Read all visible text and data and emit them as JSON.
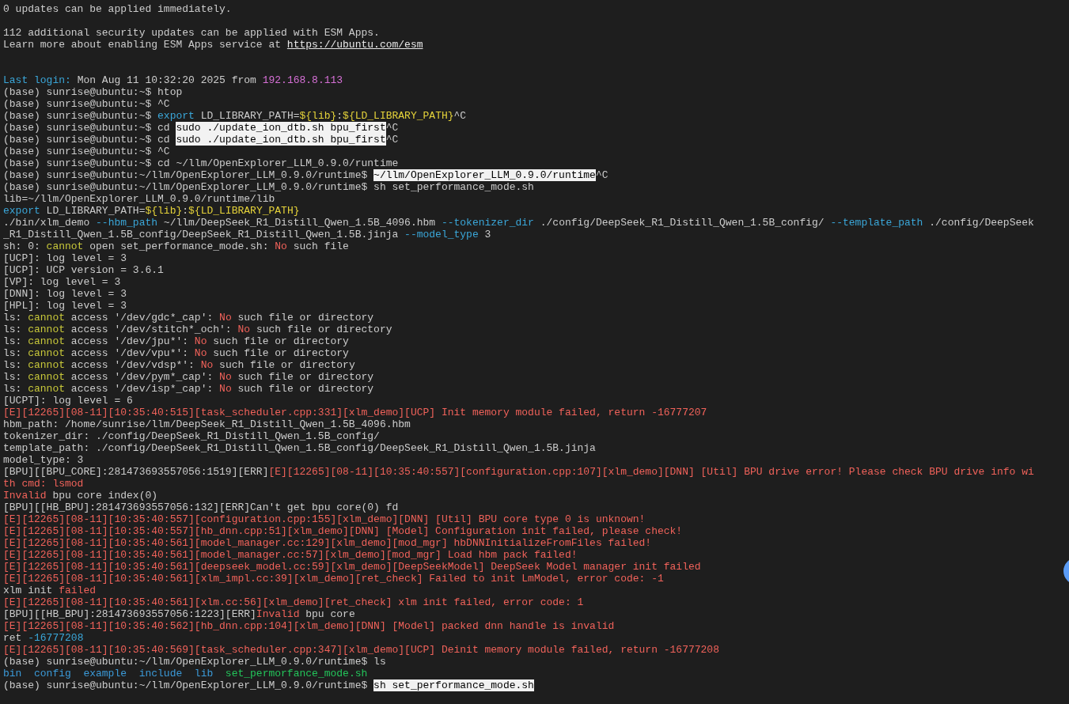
{
  "terminal": {
    "lines": [
      {
        "kind": "text",
        "segments": [
          {
            "text": "0 updates can be applied immediately.",
            "kind": "plain"
          }
        ]
      },
      {
        "kind": "blank"
      },
      {
        "kind": "text",
        "segments": [
          {
            "text": "112 additional security updates can be applied with ESM Apps.",
            "kind": "plain"
          }
        ]
      },
      {
        "kind": "text",
        "segments": [
          {
            "text": "Learn more about enabling ESM Apps service at ",
            "kind": "plain"
          },
          {
            "text": "https://ubuntu.com/esm",
            "kind": "link"
          }
        ]
      },
      {
        "kind": "blank"
      },
      {
        "kind": "blank"
      },
      {
        "kind": "text",
        "segments": [
          {
            "text": "Last login:",
            "kind": "cyan"
          },
          {
            "text": " Mon Aug 11 10:32:20 2025 from ",
            "kind": "plain"
          },
          {
            "text": "192.168.8.113",
            "kind": "magenta"
          }
        ]
      },
      {
        "kind": "text",
        "segments": [
          {
            "text": "(base) sunrise@ubuntu:~$ htop",
            "kind": "plain"
          }
        ]
      },
      {
        "kind": "text",
        "segments": [
          {
            "text": "(base) sunrise@ubuntu:~$ ^C",
            "kind": "plain"
          }
        ]
      },
      {
        "kind": "text",
        "segments": [
          {
            "text": "(base) sunrise@ubuntu:~$ ",
            "kind": "plain"
          },
          {
            "text": "export",
            "kind": "cyan"
          },
          {
            "text": " LD_LIBRARY_PATH=",
            "kind": "plain"
          },
          {
            "text": "${lib}",
            "kind": "yellow"
          },
          {
            "text": ":",
            "kind": "plain"
          },
          {
            "text": "${LD_LIBRARY_PATH}",
            "kind": "yellow"
          },
          {
            "text": "^C",
            "kind": "plain"
          }
        ]
      },
      {
        "kind": "text",
        "segments": [
          {
            "text": "(base) sunrise@ubuntu:~$ cd ",
            "kind": "plain"
          },
          {
            "text": "sudo ./update_ion_dtb.sh bpu_first",
            "kind": "highlight"
          },
          {
            "text": "^C",
            "kind": "plain"
          }
        ]
      },
      {
        "kind": "text",
        "segments": [
          {
            "text": "(base) sunrise@ubuntu:~$ cd ",
            "kind": "plain"
          },
          {
            "text": "sudo ./update_ion_dtb.sh bpu_first",
            "kind": "highlight"
          },
          {
            "text": "^C",
            "kind": "plain"
          }
        ]
      },
      {
        "kind": "text",
        "segments": [
          {
            "text": "(base) sunrise@ubuntu:~$ ^C",
            "kind": "plain"
          }
        ]
      },
      {
        "kind": "text",
        "segments": [
          {
            "text": "(base) sunrise@ubuntu:~$ cd ~/llm/OpenExplorer_LLM_0.9.0/runtime",
            "kind": "plain"
          }
        ]
      },
      {
        "kind": "text",
        "segments": [
          {
            "text": "(base) sunrise@ubuntu:~/llm/OpenExplorer_LLM_0.9.0/runtime$ ",
            "kind": "plain"
          },
          {
            "text": "~/llm/OpenExplorer_LLM_0.9.0/runtime",
            "kind": "highlight"
          },
          {
            "text": "^C",
            "kind": "plain"
          }
        ]
      },
      {
        "kind": "text",
        "segments": [
          {
            "text": "(base) sunrise@ubuntu:~/llm/OpenExplorer_LLM_0.9.0/runtime$ sh set_performance_mode.sh",
            "kind": "plain"
          }
        ]
      },
      {
        "kind": "text",
        "segments": [
          {
            "text": "lib=~/llm/OpenExplorer_LLM_0.9.0/runtime/lib",
            "kind": "plain"
          }
        ]
      },
      {
        "kind": "text",
        "segments": [
          {
            "text": "export",
            "kind": "cyan"
          },
          {
            "text": " LD_LIBRARY_PATH=",
            "kind": "plain"
          },
          {
            "text": "${lib}",
            "kind": "yellow"
          },
          {
            "text": ":",
            "kind": "plain"
          },
          {
            "text": "${LD_LIBRARY_PATH}",
            "kind": "yellow"
          }
        ]
      },
      {
        "kind": "text",
        "segments": [
          {
            "text": "./bin/xlm_demo ",
            "kind": "plain"
          },
          {
            "text": "--hbm_path",
            "kind": "cyan"
          },
          {
            "text": " ~/llm/DeepSeek_R1_Distill_Qwen_1.5B_4096.hbm ",
            "kind": "plain"
          },
          {
            "text": "--tokenizer_dir",
            "kind": "cyan"
          },
          {
            "text": " ./config/DeepSeek_R1_Distill_Qwen_1.5B_config/ ",
            "kind": "plain"
          },
          {
            "text": "--template_path",
            "kind": "cyan"
          },
          {
            "text": " ./config/DeepSeek",
            "kind": "plain"
          }
        ]
      },
      {
        "kind": "text",
        "segments": [
          {
            "text": "_R1_Distill_Qwen_1.5B_config/DeepSeek_R1_Distill_Qwen_1.5B.jinja ",
            "kind": "plain"
          },
          {
            "text": "--model_type",
            "kind": "cyan"
          },
          {
            "text": " 3",
            "kind": "plain"
          }
        ]
      },
      {
        "kind": "text",
        "segments": [
          {
            "text": "sh: 0: ",
            "kind": "plain"
          },
          {
            "text": "cannot",
            "kind": "olive"
          },
          {
            "text": " open set_performance_mode.sh: ",
            "kind": "plain"
          },
          {
            "text": "No",
            "kind": "red"
          },
          {
            "text": " such file",
            "kind": "plain"
          }
        ]
      },
      {
        "kind": "text",
        "segments": [
          {
            "text": "[UCP]: log level = 3",
            "kind": "plain"
          }
        ]
      },
      {
        "kind": "text",
        "segments": [
          {
            "text": "[UCP]: UCP version = 3.6.1",
            "kind": "plain"
          }
        ]
      },
      {
        "kind": "text",
        "segments": [
          {
            "text": "[VP]: log level = 3",
            "kind": "plain"
          }
        ]
      },
      {
        "kind": "text",
        "segments": [
          {
            "text": "[DNN]: log level = 3",
            "kind": "plain"
          }
        ]
      },
      {
        "kind": "text",
        "segments": [
          {
            "text": "[HPL]: log level = 3",
            "kind": "plain"
          }
        ]
      },
      {
        "kind": "text",
        "segments": [
          {
            "text": "ls: ",
            "kind": "plain"
          },
          {
            "text": "cannot",
            "kind": "olive"
          },
          {
            "text": " access '/dev/gdc*_cap': ",
            "kind": "plain"
          },
          {
            "text": "No",
            "kind": "red"
          },
          {
            "text": " such file or directory",
            "kind": "plain"
          }
        ]
      },
      {
        "kind": "text",
        "segments": [
          {
            "text": "ls: ",
            "kind": "plain"
          },
          {
            "text": "cannot",
            "kind": "olive"
          },
          {
            "text": " access '/dev/stitch*_och': ",
            "kind": "plain"
          },
          {
            "text": "No",
            "kind": "red"
          },
          {
            "text": " such file or directory",
            "kind": "plain"
          }
        ]
      },
      {
        "kind": "text",
        "segments": [
          {
            "text": "ls: ",
            "kind": "plain"
          },
          {
            "text": "cannot",
            "kind": "olive"
          },
          {
            "text": " access '/dev/jpu*': ",
            "kind": "plain"
          },
          {
            "text": "No",
            "kind": "red"
          },
          {
            "text": " such file or directory",
            "kind": "plain"
          }
        ]
      },
      {
        "kind": "text",
        "segments": [
          {
            "text": "ls: ",
            "kind": "plain"
          },
          {
            "text": "cannot",
            "kind": "olive"
          },
          {
            "text": " access '/dev/vpu*': ",
            "kind": "plain"
          },
          {
            "text": "No",
            "kind": "red"
          },
          {
            "text": " such file or directory",
            "kind": "plain"
          }
        ]
      },
      {
        "kind": "text",
        "segments": [
          {
            "text": "ls: ",
            "kind": "plain"
          },
          {
            "text": "cannot",
            "kind": "olive"
          },
          {
            "text": " access '/dev/vdsp*': ",
            "kind": "plain"
          },
          {
            "text": "No",
            "kind": "red"
          },
          {
            "text": " such file or directory",
            "kind": "plain"
          }
        ]
      },
      {
        "kind": "text",
        "segments": [
          {
            "text": "ls: ",
            "kind": "plain"
          },
          {
            "text": "cannot",
            "kind": "olive"
          },
          {
            "text": " access '/dev/pym*_cap': ",
            "kind": "plain"
          },
          {
            "text": "No",
            "kind": "red"
          },
          {
            "text": " such file or directory",
            "kind": "plain"
          }
        ]
      },
      {
        "kind": "text",
        "segments": [
          {
            "text": "ls: ",
            "kind": "plain"
          },
          {
            "text": "cannot",
            "kind": "olive"
          },
          {
            "text": " access '/dev/isp*_cap': ",
            "kind": "plain"
          },
          {
            "text": "No",
            "kind": "red"
          },
          {
            "text": " such file or directory",
            "kind": "plain"
          }
        ]
      },
      {
        "kind": "text",
        "segments": [
          {
            "text": "[UCPT]: log level = 6",
            "kind": "plain"
          }
        ]
      },
      {
        "kind": "text",
        "segments": [
          {
            "text": "[E][12265][08-11][10:35:40:515][task_scheduler.cpp:331][xlm_demo][UCP] Init memory module failed, return -16777207",
            "kind": "red"
          }
        ]
      },
      {
        "kind": "text",
        "segments": [
          {
            "text": "hbm_path: /home/sunrise/llm/DeepSeek_R1_Distill_Qwen_1.5B_4096.hbm",
            "kind": "plain"
          }
        ]
      },
      {
        "kind": "text",
        "segments": [
          {
            "text": "tokenizer_dir: ./config/DeepSeek_R1_Distill_Qwen_1.5B_config/",
            "kind": "plain"
          }
        ]
      },
      {
        "kind": "text",
        "segments": [
          {
            "text": "template_path: ./config/DeepSeek_R1_Distill_Qwen_1.5B_config/DeepSeek_R1_Distill_Qwen_1.5B.jinja",
            "kind": "plain"
          }
        ]
      },
      {
        "kind": "text",
        "segments": [
          {
            "text": "model_type: 3",
            "kind": "plain"
          }
        ]
      },
      {
        "kind": "text",
        "segments": [
          {
            "text": "[BPU][[BPU_CORE]:281473693557056:1519][ERR]",
            "kind": "plain"
          },
          {
            "text": "[E][12265][08-11][10:35:40:557][configuration.cpp:107][xlm_demo][DNN] [Util] BPU drive error! Please check BPU drive info wi",
            "kind": "red"
          }
        ]
      },
      {
        "kind": "text",
        "segments": [
          {
            "text": "th cmd: lsmod",
            "kind": "red"
          }
        ]
      },
      {
        "kind": "text",
        "segments": [
          {
            "text": "Invalid",
            "kind": "red"
          },
          {
            "text": " bpu core index(0)",
            "kind": "plain"
          }
        ]
      },
      {
        "kind": "text",
        "segments": [
          {
            "text": "[BPU][[HB_BPU]:281473693557056:132][ERR]Can't get bpu core(0) fd",
            "kind": "plain"
          }
        ]
      },
      {
        "kind": "text",
        "segments": [
          {
            "text": "[E][12265][08-11][10:35:40:557][configuration.cpp:155][xlm_demo][DNN] [Util] BPU core type 0 is unknown!",
            "kind": "red"
          }
        ]
      },
      {
        "kind": "text",
        "segments": [
          {
            "text": "[E][12265][08-11][10:35:40:557][hb_dnn.cpp:51][xlm_demo][DNN] [Model] Configuration init failed, please check!",
            "kind": "red"
          }
        ]
      },
      {
        "kind": "text",
        "segments": [
          {
            "text": "[E][12265][08-11][10:35:40:561][model_manager.cc:129][xlm_demo][mod_mgr] hbDNNInitializeFromFiles failed!",
            "kind": "red"
          }
        ]
      },
      {
        "kind": "text",
        "segments": [
          {
            "text": "[E][12265][08-11][10:35:40:561][model_manager.cc:57][xlm_demo][mod_mgr] Load hbm pack failed!",
            "kind": "red"
          }
        ]
      },
      {
        "kind": "text",
        "segments": [
          {
            "text": "[E][12265][08-11][10:35:40:561][deepseek_model.cc:59][xlm_demo][DeepSeekModel] DeepSeek Model manager init failed",
            "kind": "red"
          }
        ]
      },
      {
        "kind": "text",
        "segments": [
          {
            "text": "[E][12265][08-11][10:35:40:561][xlm_impl.cc:39][xlm_demo][ret_check] Failed to init LmModel, error code: -1",
            "kind": "red"
          }
        ]
      },
      {
        "kind": "text",
        "segments": [
          {
            "text": "xlm init ",
            "kind": "plain"
          },
          {
            "text": "failed",
            "kind": "red"
          }
        ]
      },
      {
        "kind": "text",
        "segments": [
          {
            "text": "[E][12265][08-11][10:35:40:561][xlm.cc:56][xlm_demo][ret_check] xlm init failed, error code: 1",
            "kind": "red"
          }
        ]
      },
      {
        "kind": "text",
        "segments": [
          {
            "text": "[BPU][[HB_BPU]:281473693557056:1223][ERR]",
            "kind": "plain"
          },
          {
            "text": "Invalid",
            "kind": "red"
          },
          {
            "text": " bpu core",
            "kind": "plain"
          }
        ]
      },
      {
        "kind": "text",
        "segments": [
          {
            "text": "[E][12265][08-11][10:35:40:562][hb_dnn.cpp:104][xlm_demo][DNN] [Model] packed dnn handle is invalid",
            "kind": "red"
          }
        ]
      },
      {
        "kind": "text",
        "segments": [
          {
            "text": "ret ",
            "kind": "plain"
          },
          {
            "text": "-16777208",
            "kind": "cyan"
          }
        ]
      },
      {
        "kind": "text",
        "segments": [
          {
            "text": "[E][12265][08-11][10:35:40:569][task_scheduler.cpp:347][xlm_demo][UCP] Deinit memory module failed, return -16777208",
            "kind": "red"
          }
        ]
      },
      {
        "kind": "text",
        "segments": [
          {
            "text": "(base) sunrise@ubuntu:~/llm/OpenExplorer_LLM_0.9.0/runtime$ ls",
            "kind": "plain"
          }
        ]
      },
      {
        "kind": "text",
        "segments": [
          {
            "text": "bin  config  example  include  lib  ",
            "kind": "blue"
          },
          {
            "text": "set_permorfance_mode.sh",
            "kind": "green"
          }
        ]
      },
      {
        "kind": "text",
        "segments": [
          {
            "text": "(base) sunrise@ubuntu:~/llm/OpenExplorer_LLM_0.9.0/runtime$ ",
            "kind": "plain"
          },
          {
            "text": "sh set_performance_mode.sh",
            "kind": "highlight"
          }
        ]
      }
    ]
  }
}
